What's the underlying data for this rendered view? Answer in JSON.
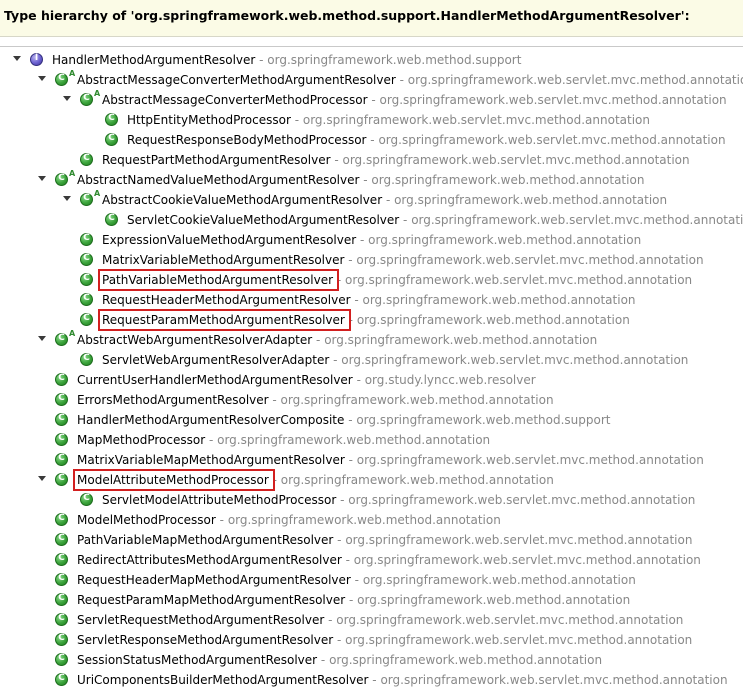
{
  "header": {
    "title": "Type hierarchy of 'org.springframework.web.method.support.HandlerMethodArgumentResolver':"
  },
  "separator": " - ",
  "rows": [
    {
      "name": "HandlerMethodArgumentResolver",
      "pkg": "org.springframework.web.method.support"
    },
    {
      "name": "AbstractMessageConverterMethodArgumentResolver",
      "pkg": "org.springframework.web.servlet.mvc.method.annotation"
    },
    {
      "name": "AbstractMessageConverterMethodProcessor",
      "pkg": "org.springframework.web.servlet.mvc.method.annotation"
    },
    {
      "name": "HttpEntityMethodProcessor",
      "pkg": "org.springframework.web.servlet.mvc.method.annotation"
    },
    {
      "name": "RequestResponseBodyMethodProcessor",
      "pkg": "org.springframework.web.servlet.mvc.method.annotation"
    },
    {
      "name": "RequestPartMethodArgumentResolver",
      "pkg": "org.springframework.web.servlet.mvc.method.annotation"
    },
    {
      "name": "AbstractNamedValueMethodArgumentResolver",
      "pkg": "org.springframework.web.method.annotation"
    },
    {
      "name": "AbstractCookieValueMethodArgumentResolver",
      "pkg": "org.springframework.web.method.annotation"
    },
    {
      "name": "ServletCookieValueMethodArgumentResolver",
      "pkg": "org.springframework.web.servlet.mvc.method.annotation"
    },
    {
      "name": "ExpressionValueMethodArgumentResolver",
      "pkg": "org.springframework.web.method.annotation"
    },
    {
      "name": "MatrixVariableMethodArgumentResolver",
      "pkg": "org.springframework.web.servlet.mvc.method.annotation"
    },
    {
      "name": "PathVariableMethodArgumentResolver",
      "pkg": "org.springframework.web.servlet.mvc.method.annotation"
    },
    {
      "name": "RequestHeaderMethodArgumentResolver",
      "pkg": "org.springframework.web.method.annotation"
    },
    {
      "name": "RequestParamMethodArgumentResolver",
      "pkg": "org.springframework.web.method.annotation"
    },
    {
      "name": "AbstractWebArgumentResolverAdapter",
      "pkg": "org.springframework.web.method.annotation"
    },
    {
      "name": "ServletWebArgumentResolverAdapter",
      "pkg": "org.springframework.web.servlet.mvc.method.annotation"
    },
    {
      "name": "CurrentUserHandlerMethodArgumentResolver",
      "pkg": "org.study.lyncc.web.resolver"
    },
    {
      "name": "ErrorsMethodArgumentResolver",
      "pkg": "org.springframework.web.method.annotation"
    },
    {
      "name": "HandlerMethodArgumentResolverComposite",
      "pkg": "org.springframework.web.method.support"
    },
    {
      "name": "MapMethodProcessor",
      "pkg": "org.springframework.web.method.annotation"
    },
    {
      "name": "MatrixVariableMapMethodArgumentResolver",
      "pkg": "org.springframework.web.servlet.mvc.method.annotation"
    },
    {
      "name": "ModelAttributeMethodProcessor",
      "pkg": "org.springframework.web.method.annotation"
    },
    {
      "name": "ServletModelAttributeMethodProcessor",
      "pkg": "org.springframework.web.servlet.mvc.method.annotation"
    },
    {
      "name": "ModelMethodProcessor",
      "pkg": "org.springframework.web.method.annotation"
    },
    {
      "name": "PathVariableMapMethodArgumentResolver",
      "pkg": "org.springframework.web.servlet.mvc.method.annotation"
    },
    {
      "name": "RedirectAttributesMethodArgumentResolver",
      "pkg": "org.springframework.web.servlet.mvc.method.annotation"
    },
    {
      "name": "RequestHeaderMapMethodArgumentResolver",
      "pkg": "org.springframework.web.method.annotation"
    },
    {
      "name": "RequestParamMapMethodArgumentResolver",
      "pkg": "org.springframework.web.method.annotation"
    },
    {
      "name": "ServletRequestMethodArgumentResolver",
      "pkg": "org.springframework.web.servlet.mvc.method.annotation"
    },
    {
      "name": "ServletResponseMethodArgumentResolver",
      "pkg": "org.springframework.web.servlet.mvc.method.annotation"
    },
    {
      "name": "SessionStatusMethodArgumentResolver",
      "pkg": "org.springframework.web.method.annotation"
    },
    {
      "name": "UriComponentsBuilderMethodArgumentResolver",
      "pkg": "org.springframework.web.servlet.mvc.method.annotation"
    }
  ],
  "icons": {
    "interface": "interface-icon",
    "class": "class-icon",
    "abstract_marker": "A"
  },
  "colors": {
    "package_text": "#888888",
    "highlight_box": "#d21f1f",
    "header_bg": "#fbfbe6"
  }
}
